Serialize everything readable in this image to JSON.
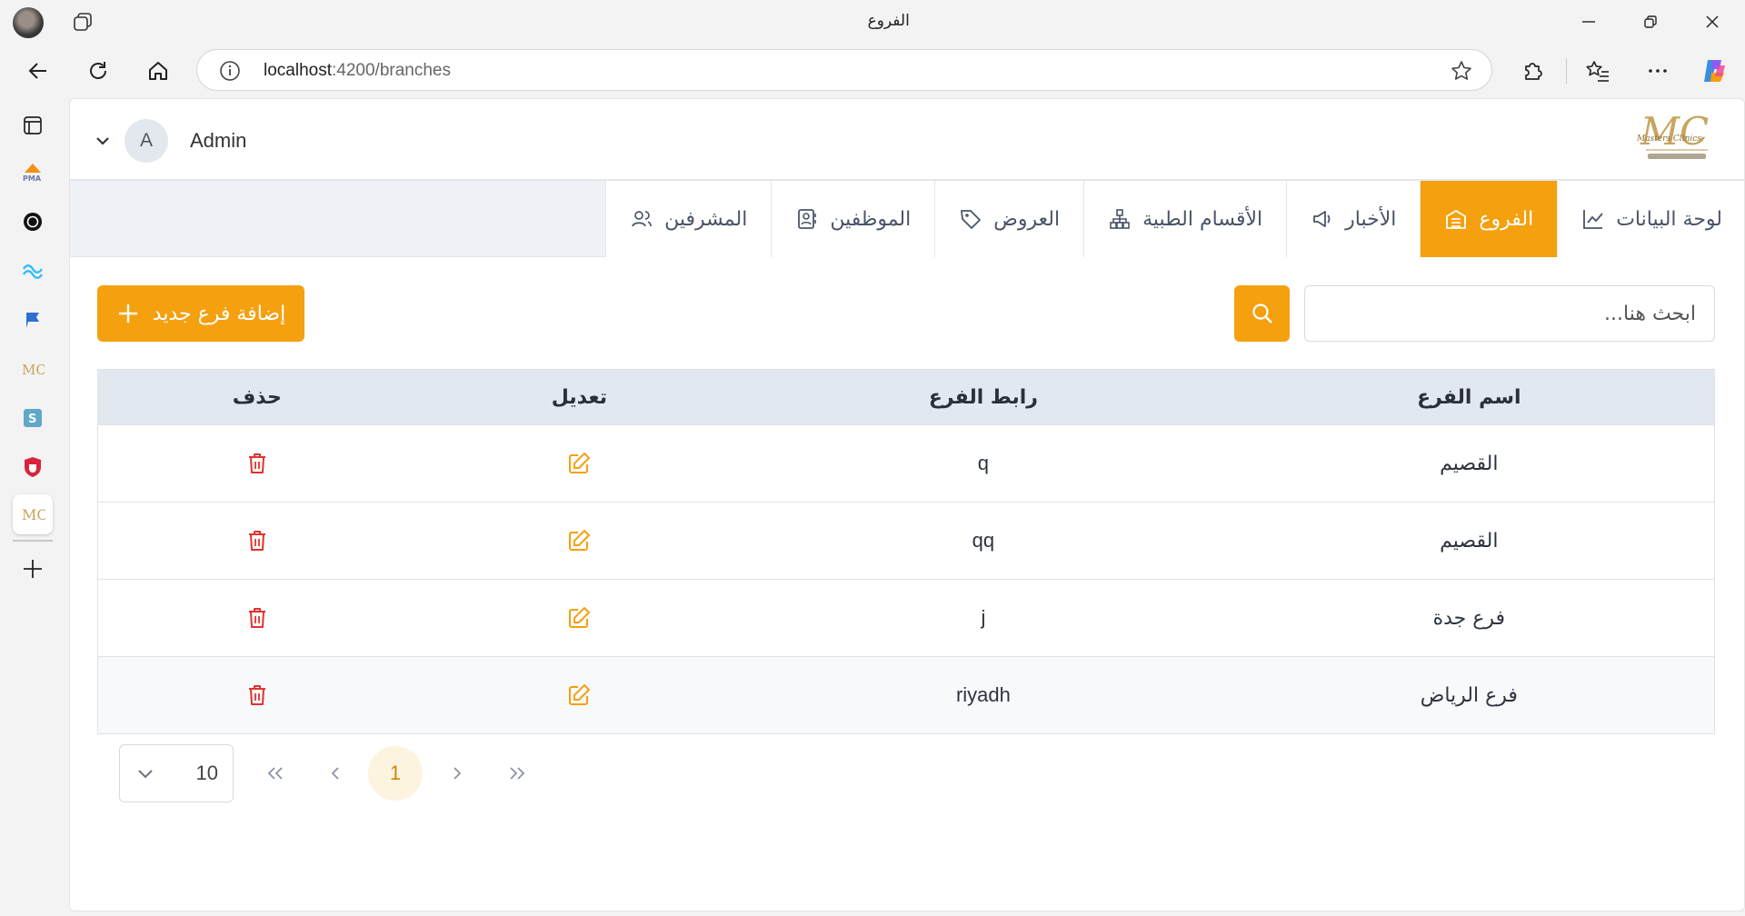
{
  "browser": {
    "tab_title": "الفروع",
    "url_host": "localhost",
    "url_rest": ":4200/branches"
  },
  "header": {
    "user_initial": "A",
    "user_name": "Admin"
  },
  "tabs": [
    {
      "label": "لوحة البيانات",
      "icon": "chart-icon",
      "active": false
    },
    {
      "label": "الفروع",
      "icon": "building-icon",
      "active": true
    },
    {
      "label": "الأخبار",
      "icon": "megaphone-icon",
      "active": false
    },
    {
      "label": "الأقسام الطبية",
      "icon": "hierarchy-icon",
      "active": false
    },
    {
      "label": "العروض",
      "icon": "tag-icon",
      "active": false
    },
    {
      "label": "الموظفين",
      "icon": "id-card-icon",
      "active": false
    },
    {
      "label": "المشرفين",
      "icon": "users-icon",
      "active": false
    }
  ],
  "toolbar": {
    "add_label": "إضافة فرع جديد",
    "search_placeholder": "ابحث هنا..."
  },
  "table": {
    "columns": [
      "اسم الفرع",
      "رابط الفرع",
      "تعديل",
      "حذف"
    ],
    "rows": [
      {
        "name": "القصيم",
        "link": "q"
      },
      {
        "name": "القصيم",
        "link": "qq"
      },
      {
        "name": "فرع جدة",
        "link": "j"
      },
      {
        "name": "فرع الرياض",
        "link": "riyadh"
      }
    ]
  },
  "pagination": {
    "rows_per_page": "10",
    "current_page": "1"
  },
  "colors": {
    "accent": "#f5a00e",
    "delete": "#e0332d",
    "header_bg": "#e2e8ef"
  }
}
